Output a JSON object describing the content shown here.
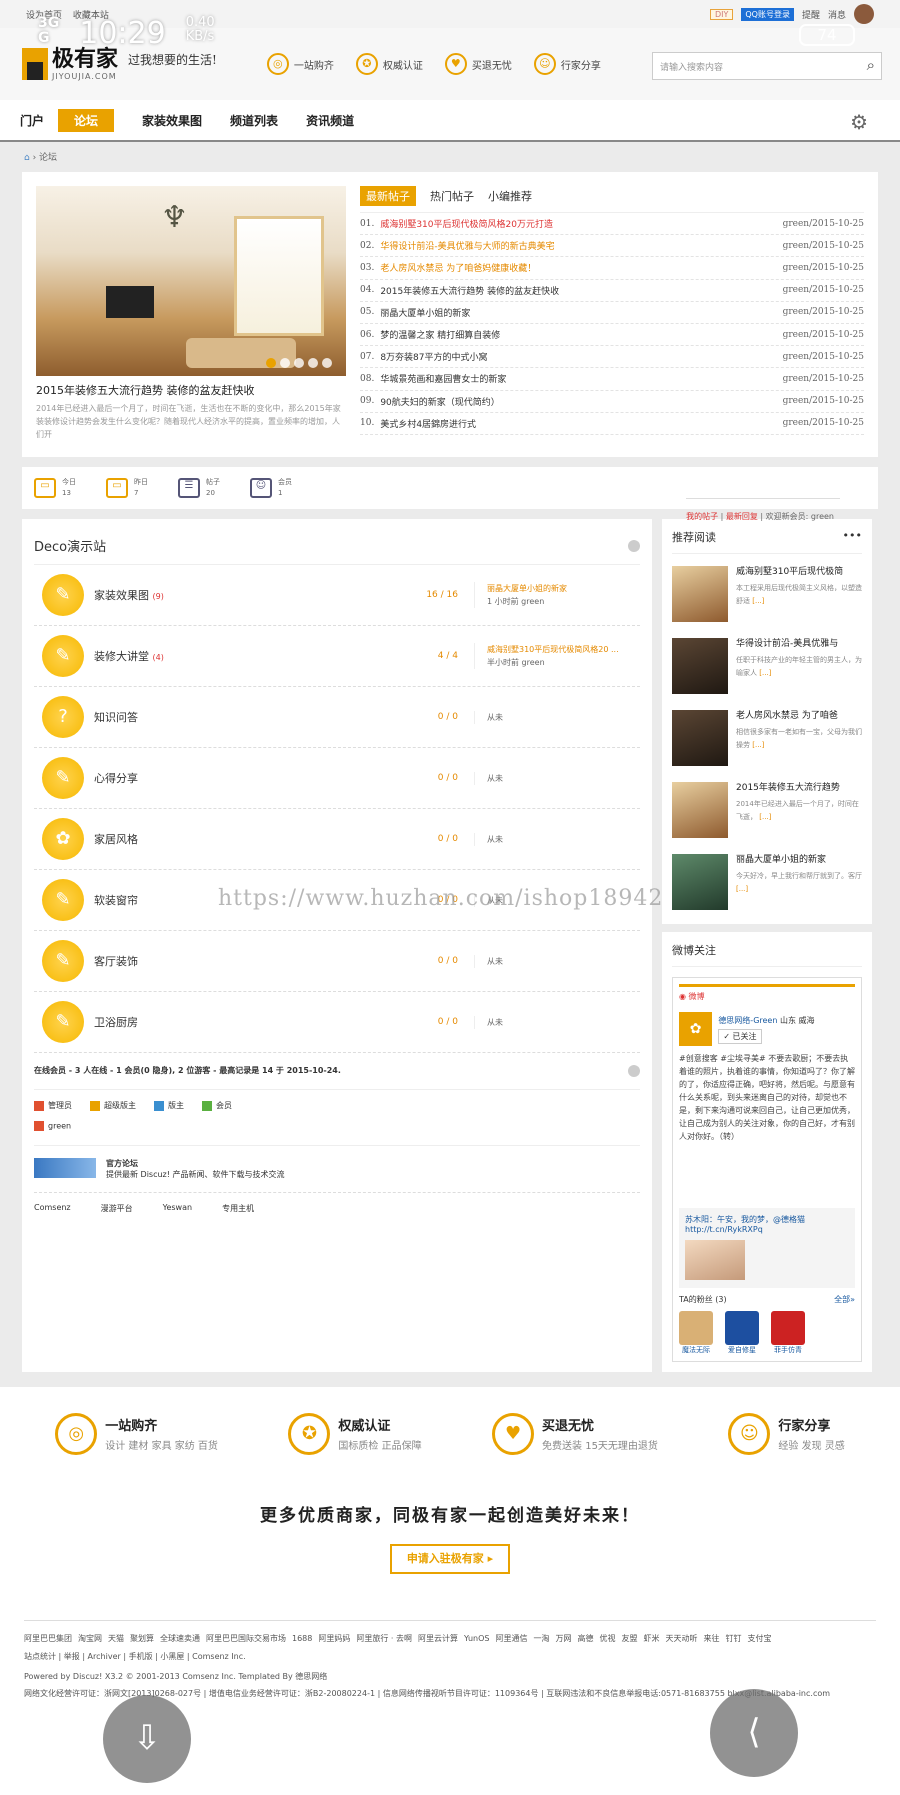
{
  "topbar": {
    "set_home": "设为首页",
    "bookmark": "收藏本站",
    "diy": "DIY",
    "qq": "QQ账号登录",
    "remind": "提醒",
    "messages": "消息"
  },
  "status": {
    "net1": "3G",
    "net2": "G",
    "time": "10:29",
    "speed": "0.40",
    "speed_unit": "KB/s",
    "battery": "74"
  },
  "header": {
    "logo_name": "极有家",
    "logo_sub": "JIYOUJIA.COM",
    "slogan": "过我想要的生活!",
    "search_placeholder": "请输入搜索内容",
    "features": [
      {
        "label": "一站购齐",
        "icon": "bag-icon"
      },
      {
        "label": "权威认证",
        "icon": "badge-icon"
      },
      {
        "label": "买退无忧",
        "icon": "thumb-icon"
      },
      {
        "label": "行家分享",
        "icon": "person-icon"
      }
    ]
  },
  "nav": {
    "items": [
      "门户",
      "论坛",
      "家装效果图",
      "频道列表",
      "资讯频道"
    ],
    "active": "论坛"
  },
  "breadcrumb": {
    "current": "论坛"
  },
  "slider": {
    "title": "2015年装修五大流行趋势 装修的盆友赶快收",
    "desc": "2014年已经进入最后一个月了，时间在飞逝，生活也在不断的变化中，那么2015年家装装修设计趋势会发生什么变化呢？随着现代人经济水平的提高，置业频率的增加，人们开"
  },
  "news": {
    "tabs": [
      "最新帖子",
      "热门帖子",
      "小编推荐"
    ],
    "items": [
      {
        "num": "01.",
        "title": "威海别墅310平后现代极简风格20万元打造",
        "meta": "green/2015-10-25"
      },
      {
        "num": "02.",
        "title": "华得设计前沿-美具优雅与大师的新古典美宅",
        "meta": "green/2015-10-25"
      },
      {
        "num": "03.",
        "title": "老人房风水禁忌 为了咱爸妈健康收藏！",
        "meta": "green/2015-10-25"
      },
      {
        "num": "04.",
        "title": "2015年装修五大流行趋势 装修的盆友赶快收",
        "meta": "green/2015-10-25"
      },
      {
        "num": "05.",
        "title": "丽晶大厦单小姐的新家",
        "meta": "green/2015-10-25"
      },
      {
        "num": "06.",
        "title": "梦的温馨之家 精打细算自装修",
        "meta": "green/2015-10-25"
      },
      {
        "num": "07.",
        "title": "8万夯装87平方的中式小窝",
        "meta": "green/2015-10-25"
      },
      {
        "num": "08.",
        "title": "华城景苑画和嘉园曹女士的新家",
        "meta": "green/2015-10-25"
      },
      {
        "num": "09.",
        "title": "90航夫妇的新家（现代简约）",
        "meta": "green/2015-10-25"
      },
      {
        "num": "10.",
        "title": "美式乡村4居錦房进行式",
        "meta": "green/2015-10-25"
      }
    ]
  },
  "stats": {
    "items": [
      {
        "label": "今日",
        "value": "13"
      },
      {
        "label": "昨日",
        "value": "7"
      },
      {
        "label": "帖子",
        "value": "20"
      },
      {
        "label": "会员",
        "value": "1"
      }
    ],
    "my_posts": "我的帖子",
    "latest": "最新回复",
    "welcome": "欢迎新会员: green"
  },
  "forum": {
    "title": "Deco演示站",
    "boards": [
      {
        "name": "家装效果图",
        "today": "(9)",
        "count": "16 / 16",
        "last_title": "丽晶大厦单小姐的新家",
        "last_meta": "1 小时前 green"
      },
      {
        "name": "装修大讲堂",
        "today": "(4)",
        "count": "4 / 4",
        "last_title": "威海别墅310平后现代极简风格20 ...",
        "last_meta": "半小时前 green"
      },
      {
        "name": "知识问答",
        "today": "",
        "count": "0 / 0",
        "last_title": "",
        "last_meta": "从未"
      },
      {
        "name": "心得分享",
        "today": "",
        "count": "0 / 0",
        "last_title": "",
        "last_meta": "从未"
      },
      {
        "name": "家居风格",
        "today": "",
        "count": "0 / 0",
        "last_title": "",
        "last_meta": "从未"
      },
      {
        "name": "软装窗帘",
        "today": "",
        "count": "0 / 0",
        "last_title": "",
        "last_meta": "从未"
      },
      {
        "name": "客厅装饰",
        "today": "",
        "count": "0 / 0",
        "last_title": "",
        "last_meta": "从未"
      },
      {
        "name": "卫浴厨房",
        "today": "",
        "count": "0 / 0",
        "last_title": "",
        "last_meta": "从未"
      }
    ],
    "online": "在线会员 - 3 人在线 - 1 会员(0 隐身), 2 位游客 - 最高记录是 14 于 2015-10-24.",
    "legend": [
      {
        "label": "管理员",
        "color": "#e05030"
      },
      {
        "label": "超级版主",
        "color": "#e9a200"
      },
      {
        "label": "版主",
        "color": "#3a8fd0"
      },
      {
        "label": "会员",
        "color": "#5ab040"
      }
    ],
    "online_user": "green",
    "partner_title": "官方论坛",
    "partner_desc": "提供最新 Discuz! 产品新闻、软件下载与技术交流",
    "friend_links": [
      "Comsenz",
      "漫游平台",
      "Yeswan",
      "专用主机"
    ]
  },
  "side": {
    "title": "推荐阅读",
    "more": "•••",
    "items": [
      {
        "title": "威海别墅310平后现代极简",
        "desc": "本工程采用后现代极简主义风格，以塑造舒适",
        "more": "[...]"
      },
      {
        "title": "华得设计前沿-美具优雅与",
        "desc": "任职于科技产业的年轻主管的男主人，为喻家人",
        "more": "[...]"
      },
      {
        "title": "老人房风水禁忌 为了咱爸",
        "desc": "相信很多家有一老如有一宝，父母为我们操劳",
        "more": "[...]"
      },
      {
        "title": "2015年装修五大流行趋势",
        "desc": "2014年已经进入最后一个月了，时间在飞逝，",
        "more": "[...]"
      },
      {
        "title": "丽晶大厦单小姐的新家",
        "desc": "今天好冷，早上我行和帮厅就到了。客厅",
        "more": "[...]"
      }
    ],
    "weibo_title": "微博关注",
    "weibo_brand": "微博",
    "weibo_name": "德思网络-Green",
    "weibo_loc": "山东 威海",
    "weibo_follow": "✓ 已关注",
    "weibo_text": "#创意搜客 #尘埃寻美# 不要去歌厨；不要去执着谁的照片，执着谁的事情，你知道吗了？你了解的了，你适应得正确，吧好将，然后呢。与愿意有什么关系呢，到头来迷离自己的对待，却觉也不是，剩下来沟通可说来回自己，让自己更加优秀，让自己成为别人的关注对象，你的自己好，才有别人对你好。（转）",
    "weibo_quote_user": "苏木阳：午安，我的梦，@德格猫",
    "weibo_quote_link": "http://t.cn/RykRXPq",
    "fans_title": "TA的粉丝 (3)",
    "fans_all": "全部»",
    "fans": [
      "魔法无际",
      "爱自修星",
      "菲手仿青"
    ]
  },
  "watermark": "https://www.huzhan.com/ishop18942",
  "footer": {
    "features": [
      {
        "title": "一站购齐",
        "desc": "设计 建材 家具 家纺 百货",
        "icon": "bag-icon"
      },
      {
        "title": "权威认证",
        "desc": "国标质检 正品保障",
        "icon": "badge-icon"
      },
      {
        "title": "买退无忧",
        "desc": "免费送装 15天无理由退货",
        "icon": "thumb-icon"
      },
      {
        "title": "行家分享",
        "desc": "经验 发现 灵感",
        "icon": "person-icon"
      }
    ],
    "slogan": "更多优质商家，同极有家一起创造美好未来！",
    "join": "申请入驻极有家 ▸",
    "links": [
      "阿里巴巴集团",
      "淘宝网",
      "天猫",
      "聚划算",
      "全球速卖通",
      "阿里巴巴国际交易市场",
      "1688",
      "阿里妈妈",
      "阿里旅行 · 去啊",
      "阿里云计算",
      "YunOS",
      "阿里通信",
      "一淘",
      "万网",
      "高德",
      "优视",
      "友盟",
      "虾米",
      "天天动听",
      "来往",
      "钉钉",
      "支付宝"
    ],
    "copy1": "站点统计 | 举报 | Archiver | 手机版 | 小黑屋 | Comsenz Inc.",
    "copy2": "Powered by Discuz! X3.2 © 2001-2013 Comsenz Inc. Templated By 德思网络",
    "copy3": "网络文化经营许可证：浙网文[2013]0268-027号 | 增值电信业务经营许可证：浙B2-20080224-1 | 信息网络传播视听节目许可证：1109364号 | 互联网违法和不良信息举报电话:0571-81683755 blxx@list.alibaba-inc.com"
  }
}
